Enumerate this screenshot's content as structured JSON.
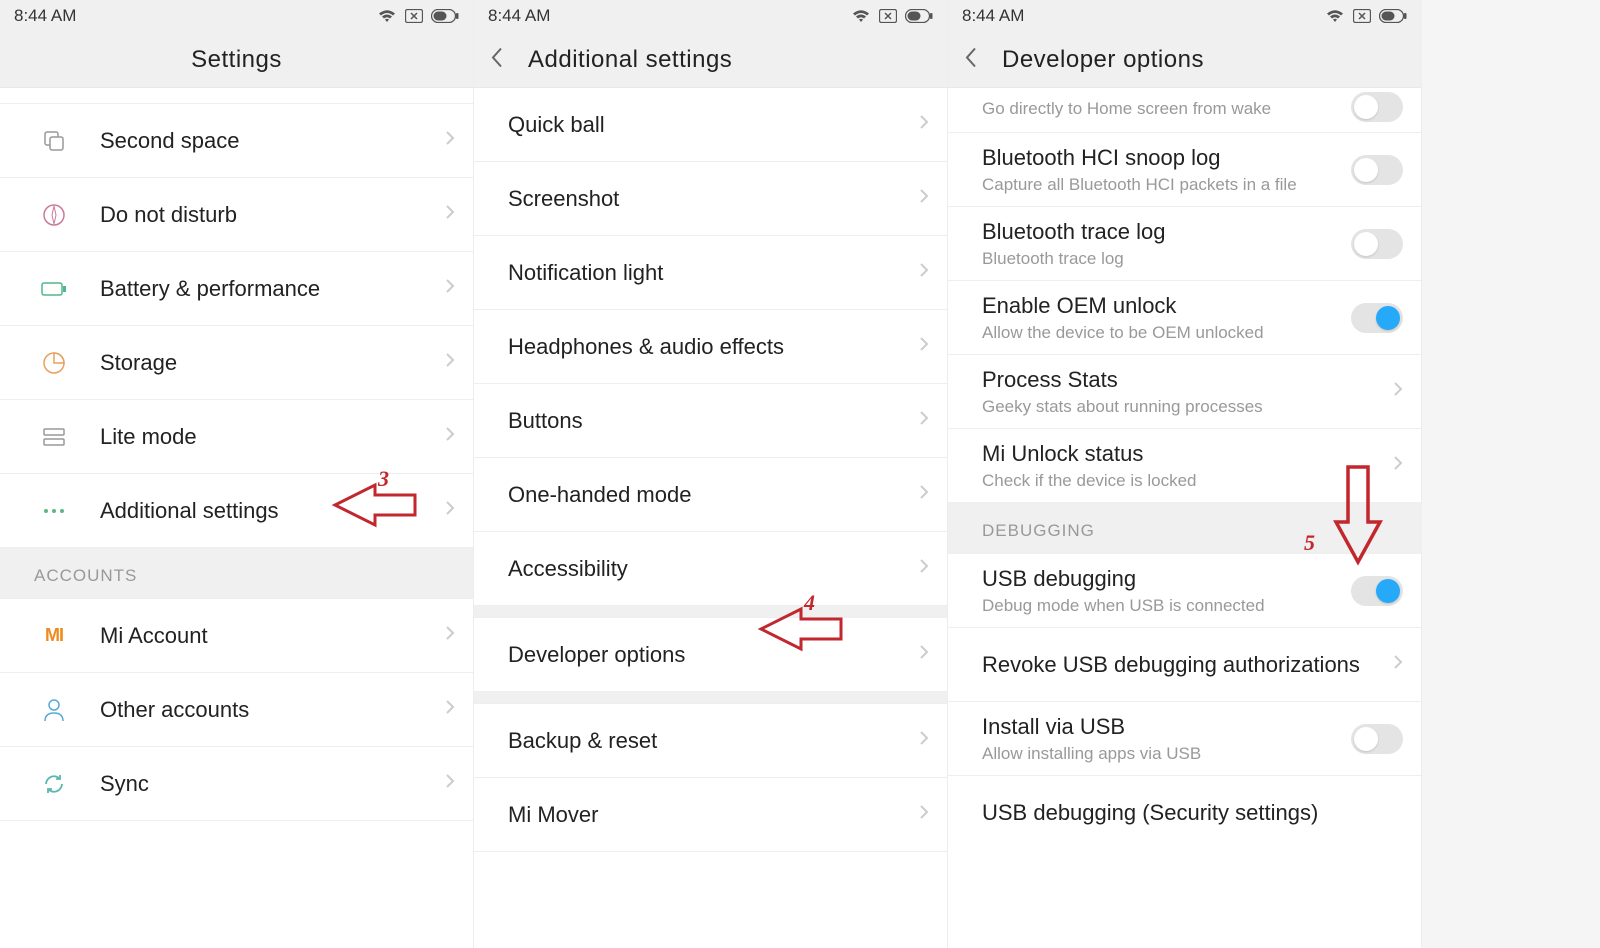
{
  "status": {
    "time": "8:44 AM"
  },
  "pane1": {
    "title": "Settings",
    "items": [
      {
        "label": "Second space",
        "icon": "copy"
      },
      {
        "label": "Do not disturb",
        "icon": "compass"
      },
      {
        "label": "Battery & performance",
        "icon": "battery"
      },
      {
        "label": "Storage",
        "icon": "storage-pie"
      },
      {
        "label": "Lite mode",
        "icon": "list"
      },
      {
        "label": "Additional settings",
        "icon": "dots"
      }
    ],
    "accounts_header": "ACCOUNTS",
    "accounts": [
      {
        "label": "Mi Account",
        "icon": "mi"
      },
      {
        "label": "Other accounts",
        "icon": "person"
      },
      {
        "label": "Sync",
        "icon": "sync"
      }
    ]
  },
  "pane2": {
    "title": "Additional  settings",
    "items": [
      {
        "label": "Quick ball"
      },
      {
        "label": "Screenshot"
      },
      {
        "label": "Notification light"
      },
      {
        "label": "Headphones & audio effects"
      },
      {
        "label": "Buttons"
      },
      {
        "label": "One-handed mode"
      },
      {
        "label": "Accessibility"
      }
    ],
    "items2": [
      {
        "label": "Developer options"
      }
    ],
    "items3": [
      {
        "label": "Backup & reset"
      },
      {
        "label": "Mi Mover"
      }
    ]
  },
  "pane3": {
    "title": "Developer  options",
    "top_cut_sub": "Go directly to Home screen from wake",
    "items1": [
      {
        "label": "Bluetooth HCI snoop log",
        "sub": "Capture all Bluetooth HCI packets in a file",
        "toggle": "off"
      },
      {
        "label": "Bluetooth trace log",
        "sub": "Bluetooth trace log",
        "toggle": "off"
      },
      {
        "label": "Enable OEM unlock",
        "sub": "Allow the device to be OEM unlocked",
        "toggle": "on"
      },
      {
        "label": "Process Stats",
        "sub": "Geeky stats about running processes",
        "chevron": true
      },
      {
        "label": "Mi Unlock status",
        "sub": "Check if the device is locked",
        "chevron": true
      }
    ],
    "debug_header": "DEBUGGING",
    "items2": [
      {
        "label": "USB debugging",
        "sub": "Debug mode when USB is connected",
        "toggle": "on"
      },
      {
        "label": "Revoke USB debugging authorizations",
        "chevron": true
      },
      {
        "label": "Install via USB",
        "sub": "Allow installing apps via USB",
        "toggle": "off"
      },
      {
        "label": "USB debugging (Security settings)"
      }
    ]
  },
  "annotations": {
    "arrow3": "3",
    "arrow4": "4",
    "arrow5": "5"
  }
}
